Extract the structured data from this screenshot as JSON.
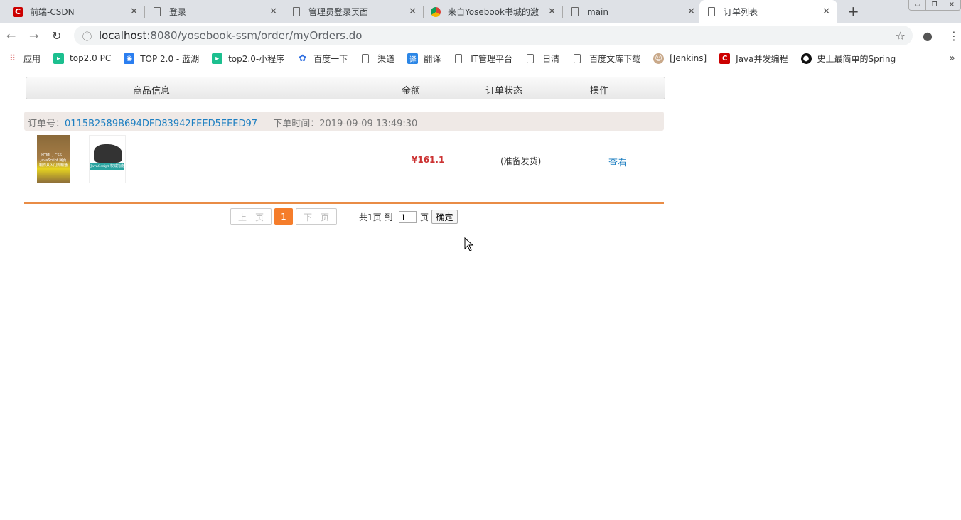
{
  "browser": {
    "tabs": [
      {
        "title": "前端-CSDN",
        "icon": "csdn-icon"
      },
      {
        "title": "登录",
        "icon": "page-icon"
      },
      {
        "title": "管理员登录页面",
        "icon": "page-icon"
      },
      {
        "title": "来自Yosebook书城的激",
        "icon": "chrome-icon"
      },
      {
        "title": "main",
        "icon": "page-icon"
      },
      {
        "title": "订单列表",
        "icon": "page-icon",
        "active": true
      }
    ],
    "close": "✕",
    "new_tab": "+",
    "url_host": "localhost",
    "url_rest": ":8080/yosebook-ssm/order/myOrders.do",
    "bookmarks": [
      {
        "label": "应用",
        "icon": "apps-icon"
      },
      {
        "label": "top2.0 PC",
        "icon": "play-icon"
      },
      {
        "label": "TOP 2.0 - 蓝湖",
        "icon": "lanhu-icon"
      },
      {
        "label": "top2.0-小程序",
        "icon": "play-icon"
      },
      {
        "label": "百度一下",
        "icon": "baidu-icon"
      },
      {
        "label": "渠道",
        "icon": "page-icon"
      },
      {
        "label": "翻译",
        "icon": "translate-icon"
      },
      {
        "label": "IT管理平台",
        "icon": "page-icon"
      },
      {
        "label": "日清",
        "icon": "page-icon"
      },
      {
        "label": "百度文库下载",
        "icon": "page-icon"
      },
      {
        "label": "[Jenkins]",
        "icon": "jenkins-icon"
      },
      {
        "label": "Java并发编程",
        "icon": "csdn-icon"
      },
      {
        "label": "史上最简单的Spring",
        "icon": "github-icon"
      }
    ],
    "more": "»"
  },
  "table": {
    "headers": [
      "商品信息",
      "金额",
      "订单状态",
      "操作"
    ]
  },
  "order": {
    "no_label": "订单号：",
    "no": "0115B2589B694DFD83942FEED5EEED97",
    "time_label": "下单时间：",
    "time": "2019-09-09 13:49:30",
    "books": [
      "HTML、CSS、JavaScript 网页制作从入门到精通",
      "JavaScript 权威指南"
    ],
    "price": "¥161.1",
    "status": "(准备发货)",
    "action": "查看"
  },
  "pagination": {
    "prev": "上一页",
    "current": "1",
    "next": "下一页",
    "total": "共1页 到",
    "page_input": "1",
    "page_unit": "页",
    "confirm": "确定"
  },
  "colors": {
    "accent": "#f57d2b",
    "link": "#1e7fc1",
    "price": "#cc3333"
  }
}
